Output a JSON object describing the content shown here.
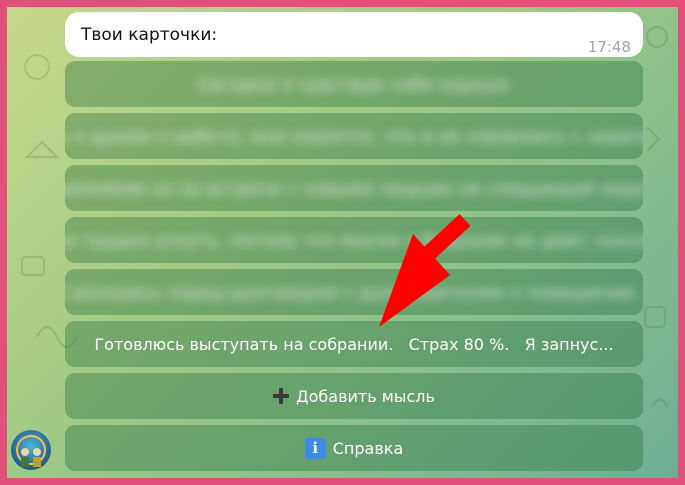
{
  "message": {
    "text": "Твои карточки:",
    "time": "17:48"
  },
  "cards": [
    {
      "label": "Сегодня я чувствую себя хорошо"
    },
    {
      "label": "Когда я думаю о работе, мне кажется, что я не справлюсь с задачами..."
    },
    {
      "label": "Я переживаю из-за встречи с новыми людьми на следующей неделе..."
    },
    {
      "label": "Мне трудно уснуть, потому что мысли о будущем не дают покоя..."
    },
    {
      "label": "Я волнуюсь перед разговором с руководителем о повышении..."
    },
    {
      "label": "Готовлюсь выступать на собрании.   Страх 80 %.   Я запнус..."
    }
  ],
  "actions": {
    "add_thought": "Добавить мысль",
    "help": "Справка"
  },
  "icons": {
    "add": "plus-icon",
    "help": "info-icon"
  },
  "colors": {
    "frame": "#e0507a",
    "arrow": "#ff0000",
    "info_badge": "#3d8be8"
  }
}
